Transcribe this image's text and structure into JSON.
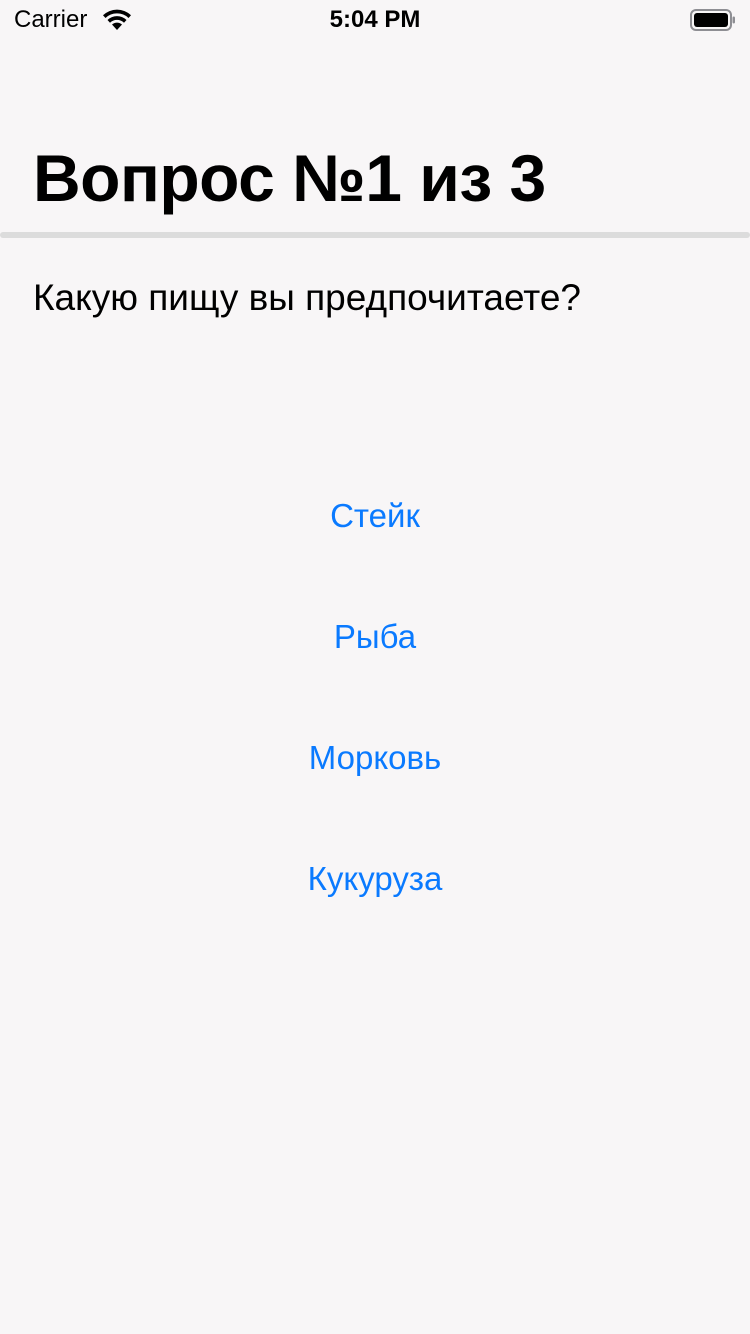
{
  "status_bar": {
    "carrier": "Carrier",
    "time": "5:04 PM",
    "wifi_icon": "wifi-icon",
    "battery_icon": "battery-icon"
  },
  "header": {
    "title": "Вопрос №1 из 3"
  },
  "question": {
    "text": "Какую пищу вы предпочитаете?"
  },
  "answers": [
    {
      "label": "Стейк"
    },
    {
      "label": "Рыба"
    },
    {
      "label": "Морковь"
    },
    {
      "label": "Кукуруза"
    }
  ],
  "colors": {
    "background": "#f8f6f7",
    "accent": "#0a7aff",
    "divider": "#dcdcdc"
  }
}
